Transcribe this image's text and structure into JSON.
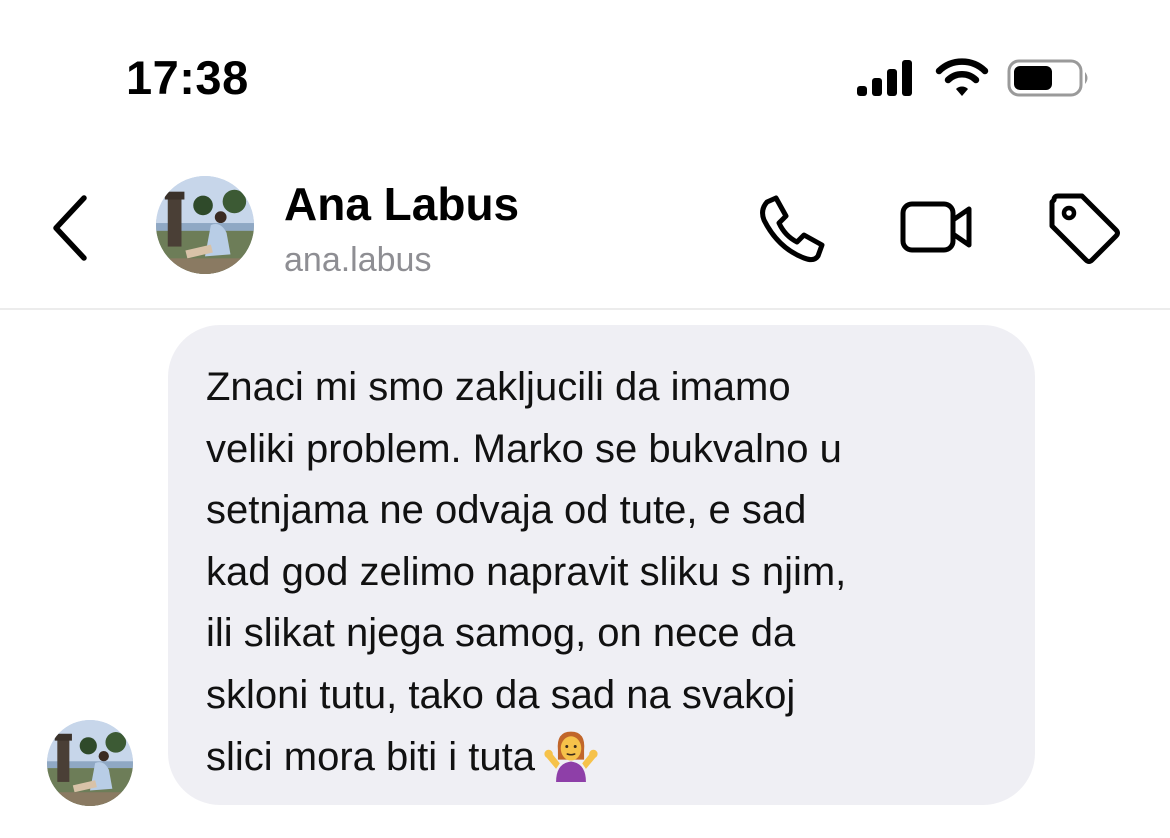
{
  "status_bar": {
    "time": "17:38",
    "icons": [
      "cellular-signal-icon",
      "wifi-icon",
      "battery-icon"
    ]
  },
  "header": {
    "back_icon": "chevron-left-icon",
    "contact_name": "Ana Labus",
    "contact_handle": "ana.labus",
    "actions": [
      "phone-icon",
      "video-camera-icon",
      "tag-icon"
    ]
  },
  "conversation": {
    "messages": [
      {
        "sender": "received",
        "text": "Znaci mi smo zakljucili da imamo\nveliki problem. Marko se bukvalno u\nsetnjama ne odvaja od tute, e sad\nkad god zelimo napravit sliku s njim,\nili slikat njega samog, on nece da\nskloni tutu, tako da sad na svakoj\nslici mora biti i tuta",
        "emoji": "person-shrugging-emoji"
      }
    ]
  },
  "colors": {
    "bubble_background": "#efeff4",
    "secondary_text": "#8e8e93",
    "divider": "#ececec"
  }
}
